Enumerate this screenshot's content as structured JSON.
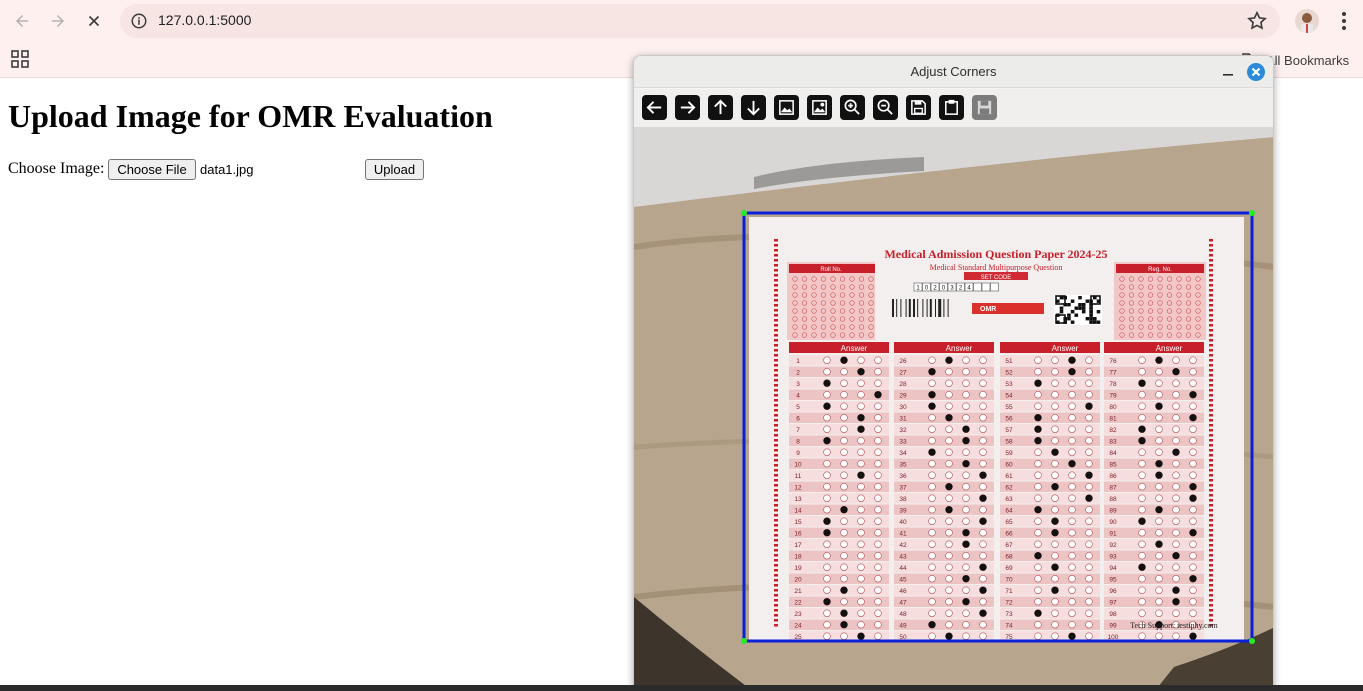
{
  "browser": {
    "url": "127.0.0.1:5000",
    "bookmarks_label": "All Bookmarks"
  },
  "page": {
    "title": "Upload Image for OMR Evaluation",
    "choose_label": "Choose Image:",
    "file_button": "Choose File",
    "file_name": "data1.jpg",
    "upload_button": "Upload"
  },
  "window": {
    "title": "Adjust Corners",
    "tools": [
      "arrow-left-icon",
      "arrow-right-icon",
      "arrow-up-icon",
      "arrow-down-icon",
      "image-icon",
      "image-settings-icon",
      "zoom-in-icon",
      "zoom-out-icon",
      "save-icon",
      "clipboard-icon",
      "floppy-icon"
    ]
  },
  "sheet": {
    "title": "Medical Admission Question Paper 2024-25",
    "subtitle": "Medical Standard Multipurpose Question",
    "set_code": "SET CODE",
    "roll_label": "Roll No.",
    "reg_label": "Reg. No.",
    "answer_label": "Answer",
    "omr_tag": "OMR",
    "code_digits": [
      "1",
      "0",
      "2",
      "0",
      "3",
      "2",
      "4"
    ],
    "footer": "Tech Support: testiphy.com",
    "columns": [
      {
        "start": 1,
        "end": 25
      },
      {
        "start": 26,
        "end": 50
      },
      {
        "start": 51,
        "end": 75
      },
      {
        "start": 76,
        "end": 100
      }
    ]
  },
  "colors": {
    "accent_blue": "#0a1fd8",
    "corner_green": "#22ee22",
    "sheet_red": "#c8202a"
  }
}
